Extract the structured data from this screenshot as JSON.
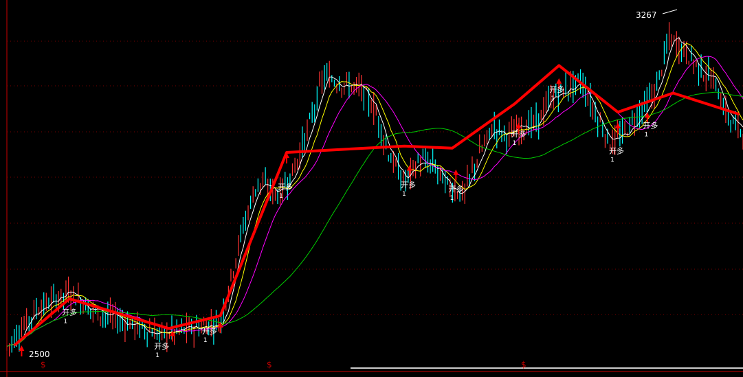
{
  "chart_data": {
    "type": "line",
    "title": "",
    "xlabel": "",
    "ylabel": "",
    "price_high_label": "3267",
    "price_low_label": "2500",
    "ylim": [
      2450,
      3300
    ],
    "signal_label": "开多",
    "signal_count_label": "1",
    "marker_symbol": "$",
    "colors": {
      "background": "#000000",
      "axis": "#cc0000",
      "grid": "#7a0000",
      "ma_short": "#ffffff",
      "ma_mid": "#ffff00",
      "ma_long": "#ff00ff",
      "ma_slow": "#00cc00",
      "trend": "#ff0000",
      "bar_up": "#ff3333",
      "bar_down": "#00ffff"
    },
    "trend_line": {
      "x": [
        0.01,
        0.085,
        0.22,
        0.29,
        0.38,
        0.54,
        0.605,
        0.69,
        0.75,
        0.83,
        0.905,
        0.995
      ],
      "y": [
        2505,
        2615,
        2545,
        2575,
        2960,
        2975,
        2970,
        3075,
        3165,
        3055,
        3100,
        3050
      ]
    },
    "signals": [
      {
        "x": 0.02,
        "y": 2505,
        "label_x": 0.075,
        "label_y": 2600
      },
      {
        "x": 0.225,
        "y": 2540,
        "label_x": 0.2,
        "label_y": 2520
      },
      {
        "x": 0.29,
        "y": 2560,
        "label_x": 0.265,
        "label_y": 2555
      },
      {
        "x": 0.38,
        "y": 2960,
        "label_x": 0.368,
        "label_y": 2895
      },
      {
        "x": 0.547,
        "y": 2930,
        "label_x": 0.535,
        "label_y": 2900
      },
      {
        "x": 0.61,
        "y": 2920,
        "label_x": 0.6,
        "label_y": 2890
      },
      {
        "x": 0.695,
        "y": 3030,
        "label_x": 0.685,
        "label_y": 3020
      },
      {
        "x": 0.75,
        "y": 3135,
        "label_x": 0.737,
        "label_y": 3125
      },
      {
        "x": 0.83,
        "y": 3030,
        "label_x": 0.818,
        "label_y": 2980
      },
      {
        "x": 0.87,
        "y": 3055,
        "label_x": 0.864,
        "label_y": 3040
      }
    ]
  }
}
